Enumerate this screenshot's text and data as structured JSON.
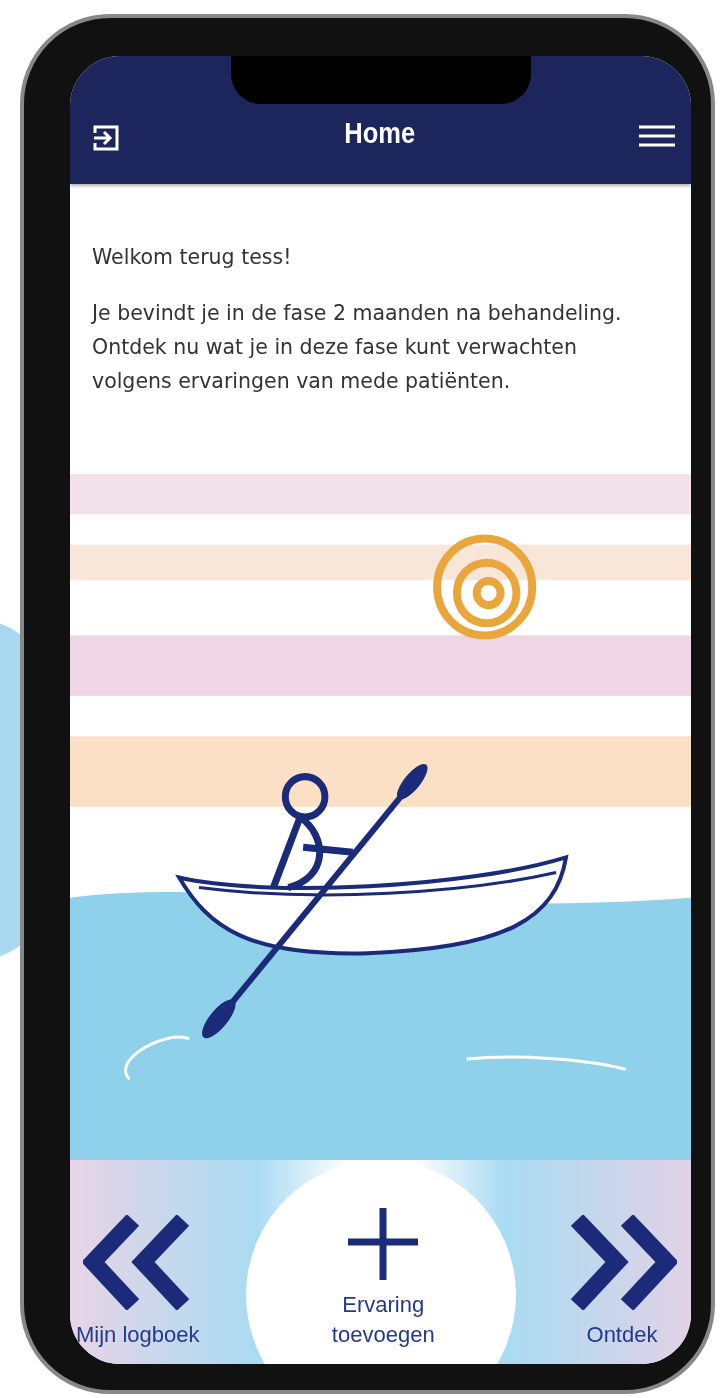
{
  "header": {
    "title": "Home"
  },
  "welcome": "Welkom terug tess!",
  "intro": "Je bevindt je in de fase 2 maanden na behandeling. Ontdek nu wat je in deze fase kunt verwachten volgens ervaringen van mede patiënten.",
  "nav": [
    {
      "kind": "back",
      "label": "Mijn logboek"
    },
    {
      "kind": "add",
      "label": "Ervaring toevoegen"
    },
    {
      "kind": "forward",
      "label": "Ontdek"
    }
  ]
}
